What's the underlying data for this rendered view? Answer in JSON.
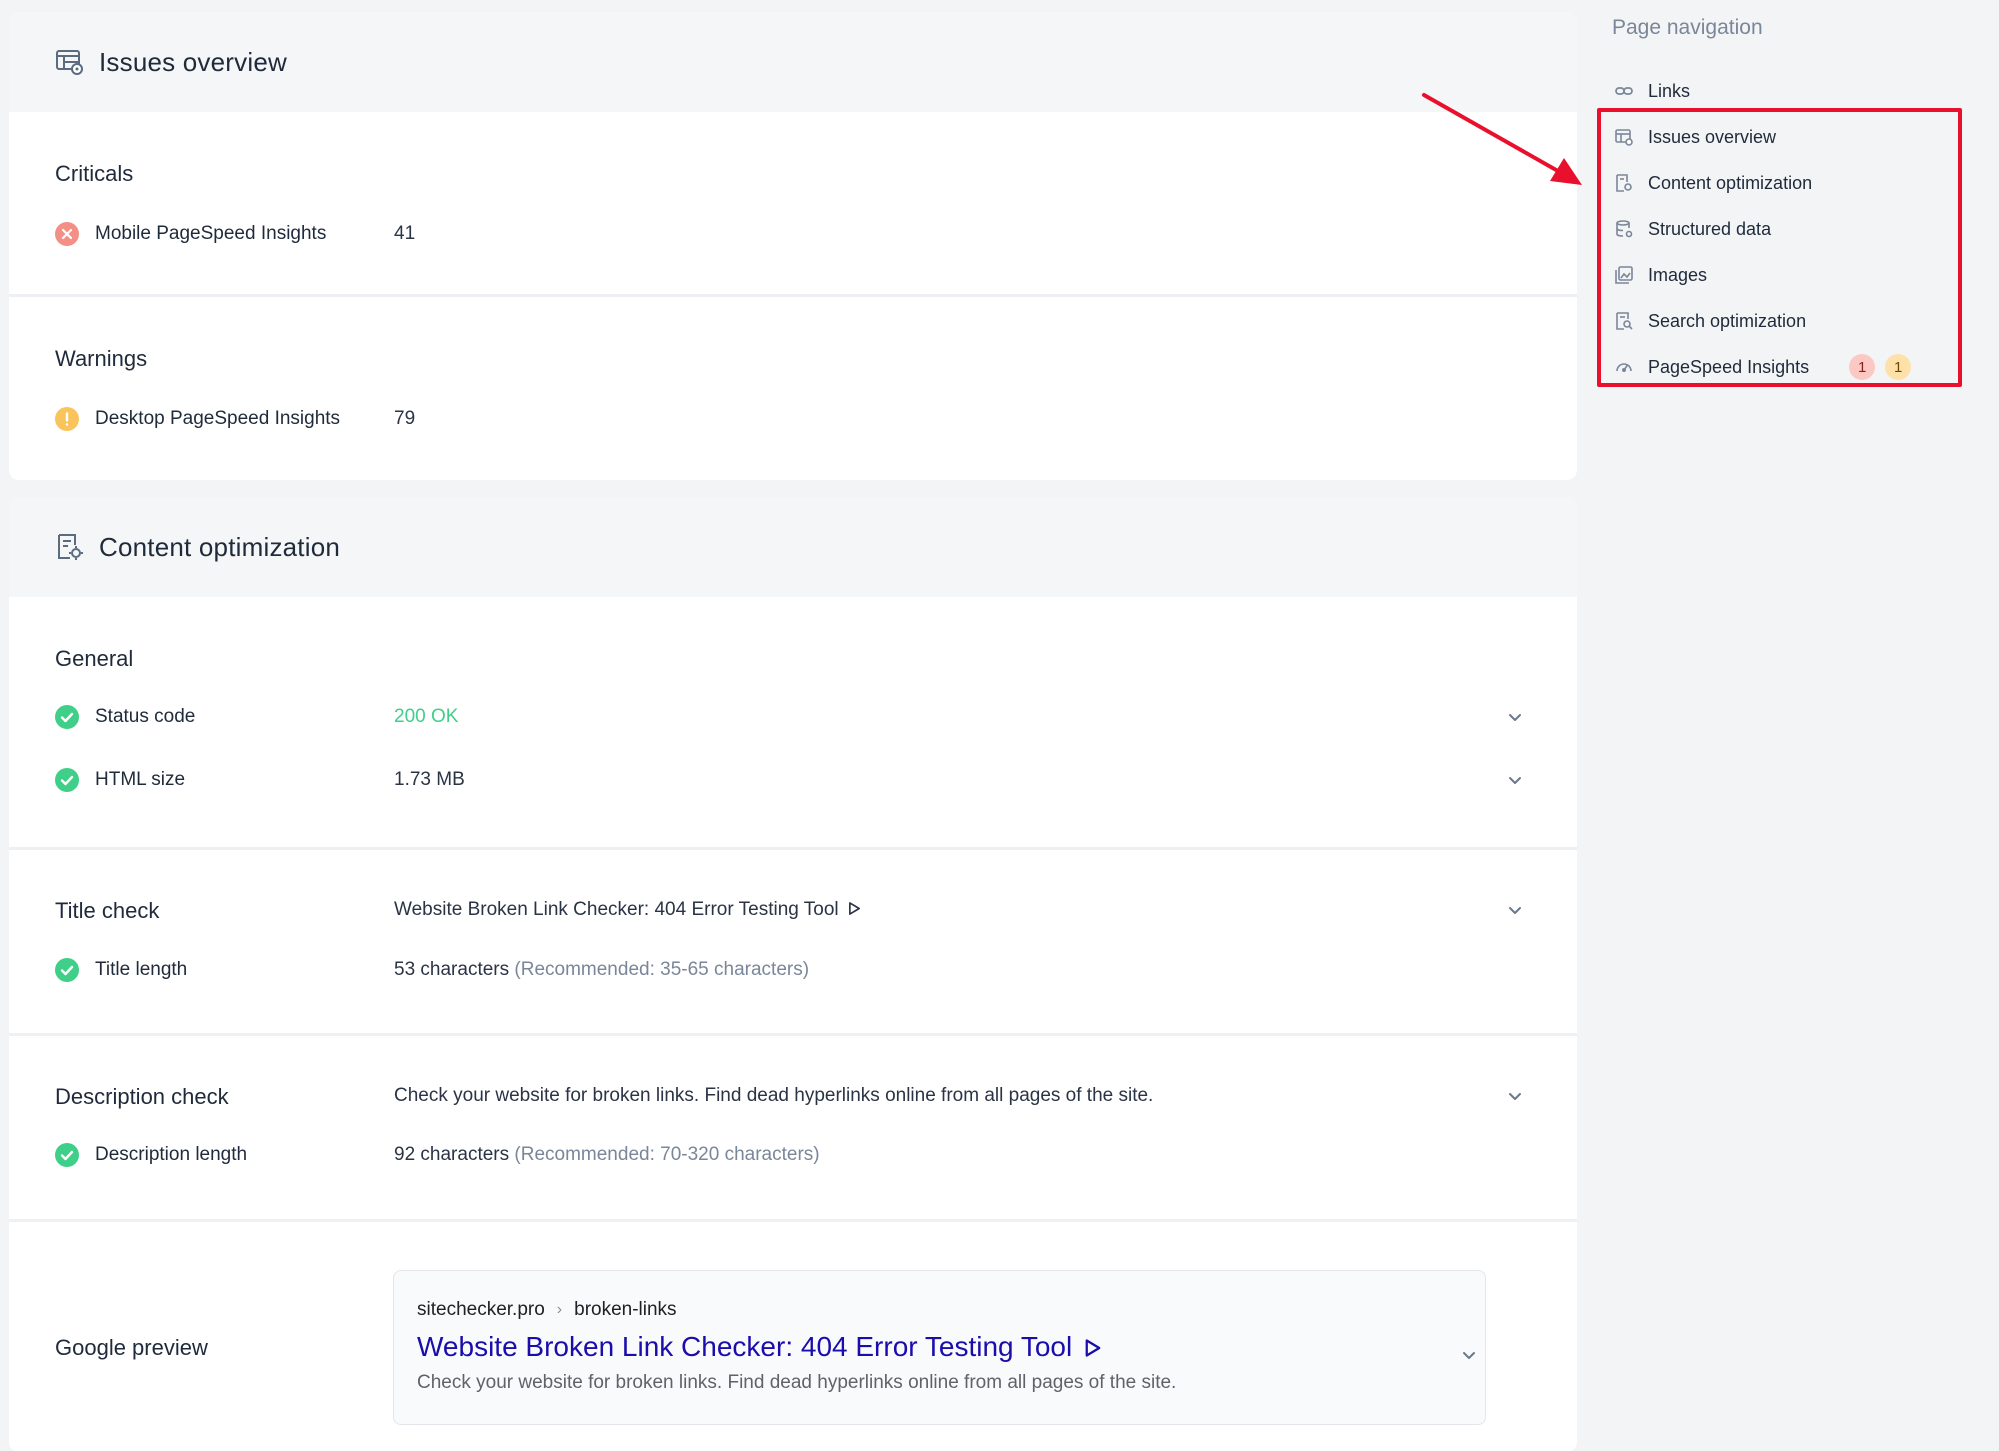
{
  "issues_overview": {
    "title": "Issues overview",
    "criticals": {
      "title": "Criticals",
      "items": [
        {
          "label": "Mobile PageSpeed Insights",
          "value": "41"
        }
      ]
    },
    "warnings": {
      "title": "Warnings",
      "items": [
        {
          "label": "Desktop PageSpeed Insights",
          "value": "79"
        }
      ]
    }
  },
  "content_optimization": {
    "title": "Content optimization",
    "general": {
      "title": "General",
      "status_code": {
        "label": "Status code",
        "value": "200 OK"
      },
      "html_size": {
        "label": "HTML size",
        "value": "1.73 MB"
      }
    },
    "title_check": {
      "title": "Title check",
      "value": "Website Broken Link Checker: 404 Error Testing Tool",
      "length_label": "Title length",
      "length_value": "53 characters",
      "length_recommended": "(Recommended: 35-65 characters)"
    },
    "description_check": {
      "title": "Description check",
      "value": "Check your website for broken links. Find dead hyperlinks online from all pages of the site.",
      "length_label": "Description length",
      "length_value": "92 characters",
      "length_recommended": "(Recommended: 70-320 characters)"
    },
    "google_preview": {
      "title": "Google preview",
      "domain": "sitechecker.pro",
      "separator": "›",
      "path": "broken-links",
      "page_title": "Website Broken Link Checker: 404 Error Testing Tool",
      "description": "Check your website for broken links. Find dead hyperlinks online from all pages of the site."
    }
  },
  "sidebar": {
    "title": "Page navigation",
    "items": [
      {
        "label": "Links",
        "icon": "link-icon"
      },
      {
        "label": "Issues overview",
        "icon": "issues-icon"
      },
      {
        "label": "Content optimization",
        "icon": "content-icon"
      },
      {
        "label": "Structured data",
        "icon": "database-icon"
      },
      {
        "label": "Images",
        "icon": "image-icon"
      },
      {
        "label": "Search optimization",
        "icon": "search-doc-icon"
      },
      {
        "label": "PageSpeed Insights",
        "icon": "speed-icon",
        "badge_critical": "1",
        "badge_warning": "1"
      }
    ]
  },
  "colors": {
    "ok": "#3fcf88",
    "warning": "#f9c45b",
    "error": "#f48f86",
    "link": "#1a0dab",
    "highlight": "#e8102c"
  }
}
